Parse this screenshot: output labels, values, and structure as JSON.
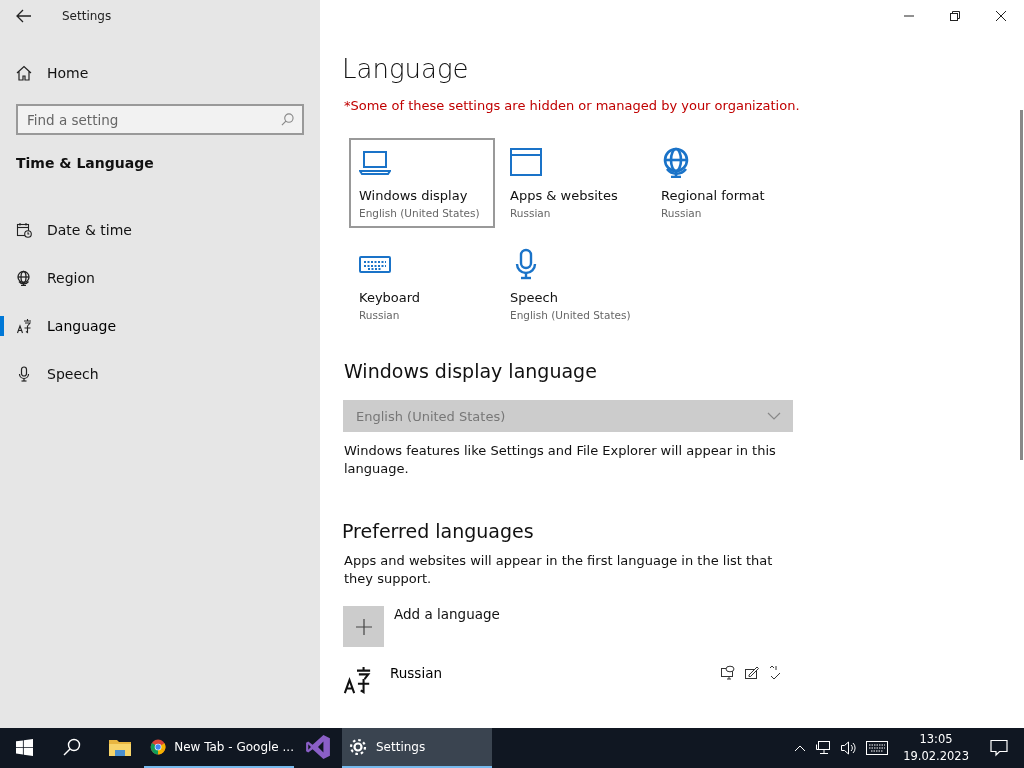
{
  "window": {
    "title": "Settings"
  },
  "sidebar": {
    "home": "Home",
    "search": {
      "placeholder": "Find a setting"
    },
    "section": "Time & Language",
    "items": [
      {
        "label": "Date & time",
        "kind": "calendar",
        "selected": false
      },
      {
        "label": "Region",
        "kind": "globe",
        "selected": false
      },
      {
        "label": "Language",
        "kind": "language",
        "selected": true
      },
      {
        "label": "Speech",
        "kind": "microphone",
        "selected": false
      }
    ]
  },
  "page": {
    "title": "Language",
    "notice": "*Some of these settings are hidden or managed by your organization.",
    "tiles": [
      {
        "title": "Windows display",
        "value": "English (United States)",
        "kind": "laptop",
        "selected": true
      },
      {
        "title": "Apps & websites",
        "value": "Russian",
        "kind": "window",
        "selected": false
      },
      {
        "title": "Regional format",
        "value": "Russian",
        "kind": "globe",
        "selected": false
      },
      {
        "title": "Keyboard",
        "value": "Russian",
        "kind": "keyboard",
        "selected": false
      },
      {
        "title": "Speech",
        "value": "English (United States)",
        "kind": "microphone",
        "selected": false
      }
    ],
    "display_language": {
      "heading": "Windows display language",
      "dropdown": {
        "value": "English (United States)",
        "disabled": true
      },
      "description": "Windows features like Settings and File Explorer will appear in this language."
    },
    "preferred": {
      "heading": "Preferred languages",
      "description": "Apps and websites will appear in the first language in the list that they support.",
      "add_label": "Add a language",
      "languages": [
        {
          "name": "Russian"
        }
      ]
    }
  },
  "taskbar": {
    "apps": [
      {
        "kind": "start",
        "active": false,
        "running": false
      },
      {
        "kind": "search",
        "active": false,
        "running": false
      },
      {
        "kind": "explorer",
        "active": false,
        "running": false
      },
      {
        "kind": "chrome",
        "label": "New Tab - Google ...",
        "active": false,
        "running": true
      },
      {
        "kind": "vs",
        "active": false,
        "running": false
      },
      {
        "kind": "settings",
        "label": "Settings",
        "active": true,
        "running": true
      }
    ],
    "time": "13:05",
    "date": "19.02.2023"
  }
}
